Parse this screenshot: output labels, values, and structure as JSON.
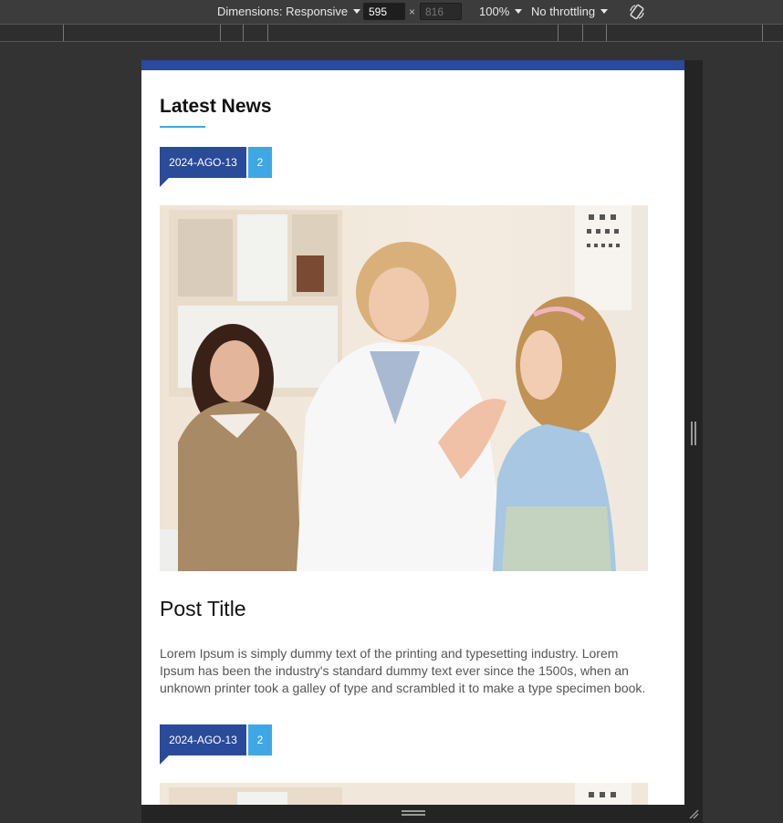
{
  "devtools": {
    "dimensions_label": "Dimensions: Responsive",
    "width_value": "595",
    "height_placeholder": "816",
    "times": "×",
    "zoom": "100%",
    "throttling": "No throttling",
    "rotate_icon": "rotate-icon"
  },
  "page": {
    "section_title": "Latest News",
    "accent_color": "#3fa7e6",
    "brand_color": "#2a4a9a",
    "posts": [
      {
        "date": "2024-AGO-13",
        "comments": "2",
        "title": "Post Title",
        "excerpt": "Lorem Ipsum is simply dummy text of the printing and typesetting industry. Lorem Ipsum has been the industry's standard dummy text ever since the 1500s, when an unknown printer took a galley of type and scrambled it to make a type specimen book."
      },
      {
        "date": "2024-AGO-13",
        "comments": "2"
      }
    ]
  }
}
